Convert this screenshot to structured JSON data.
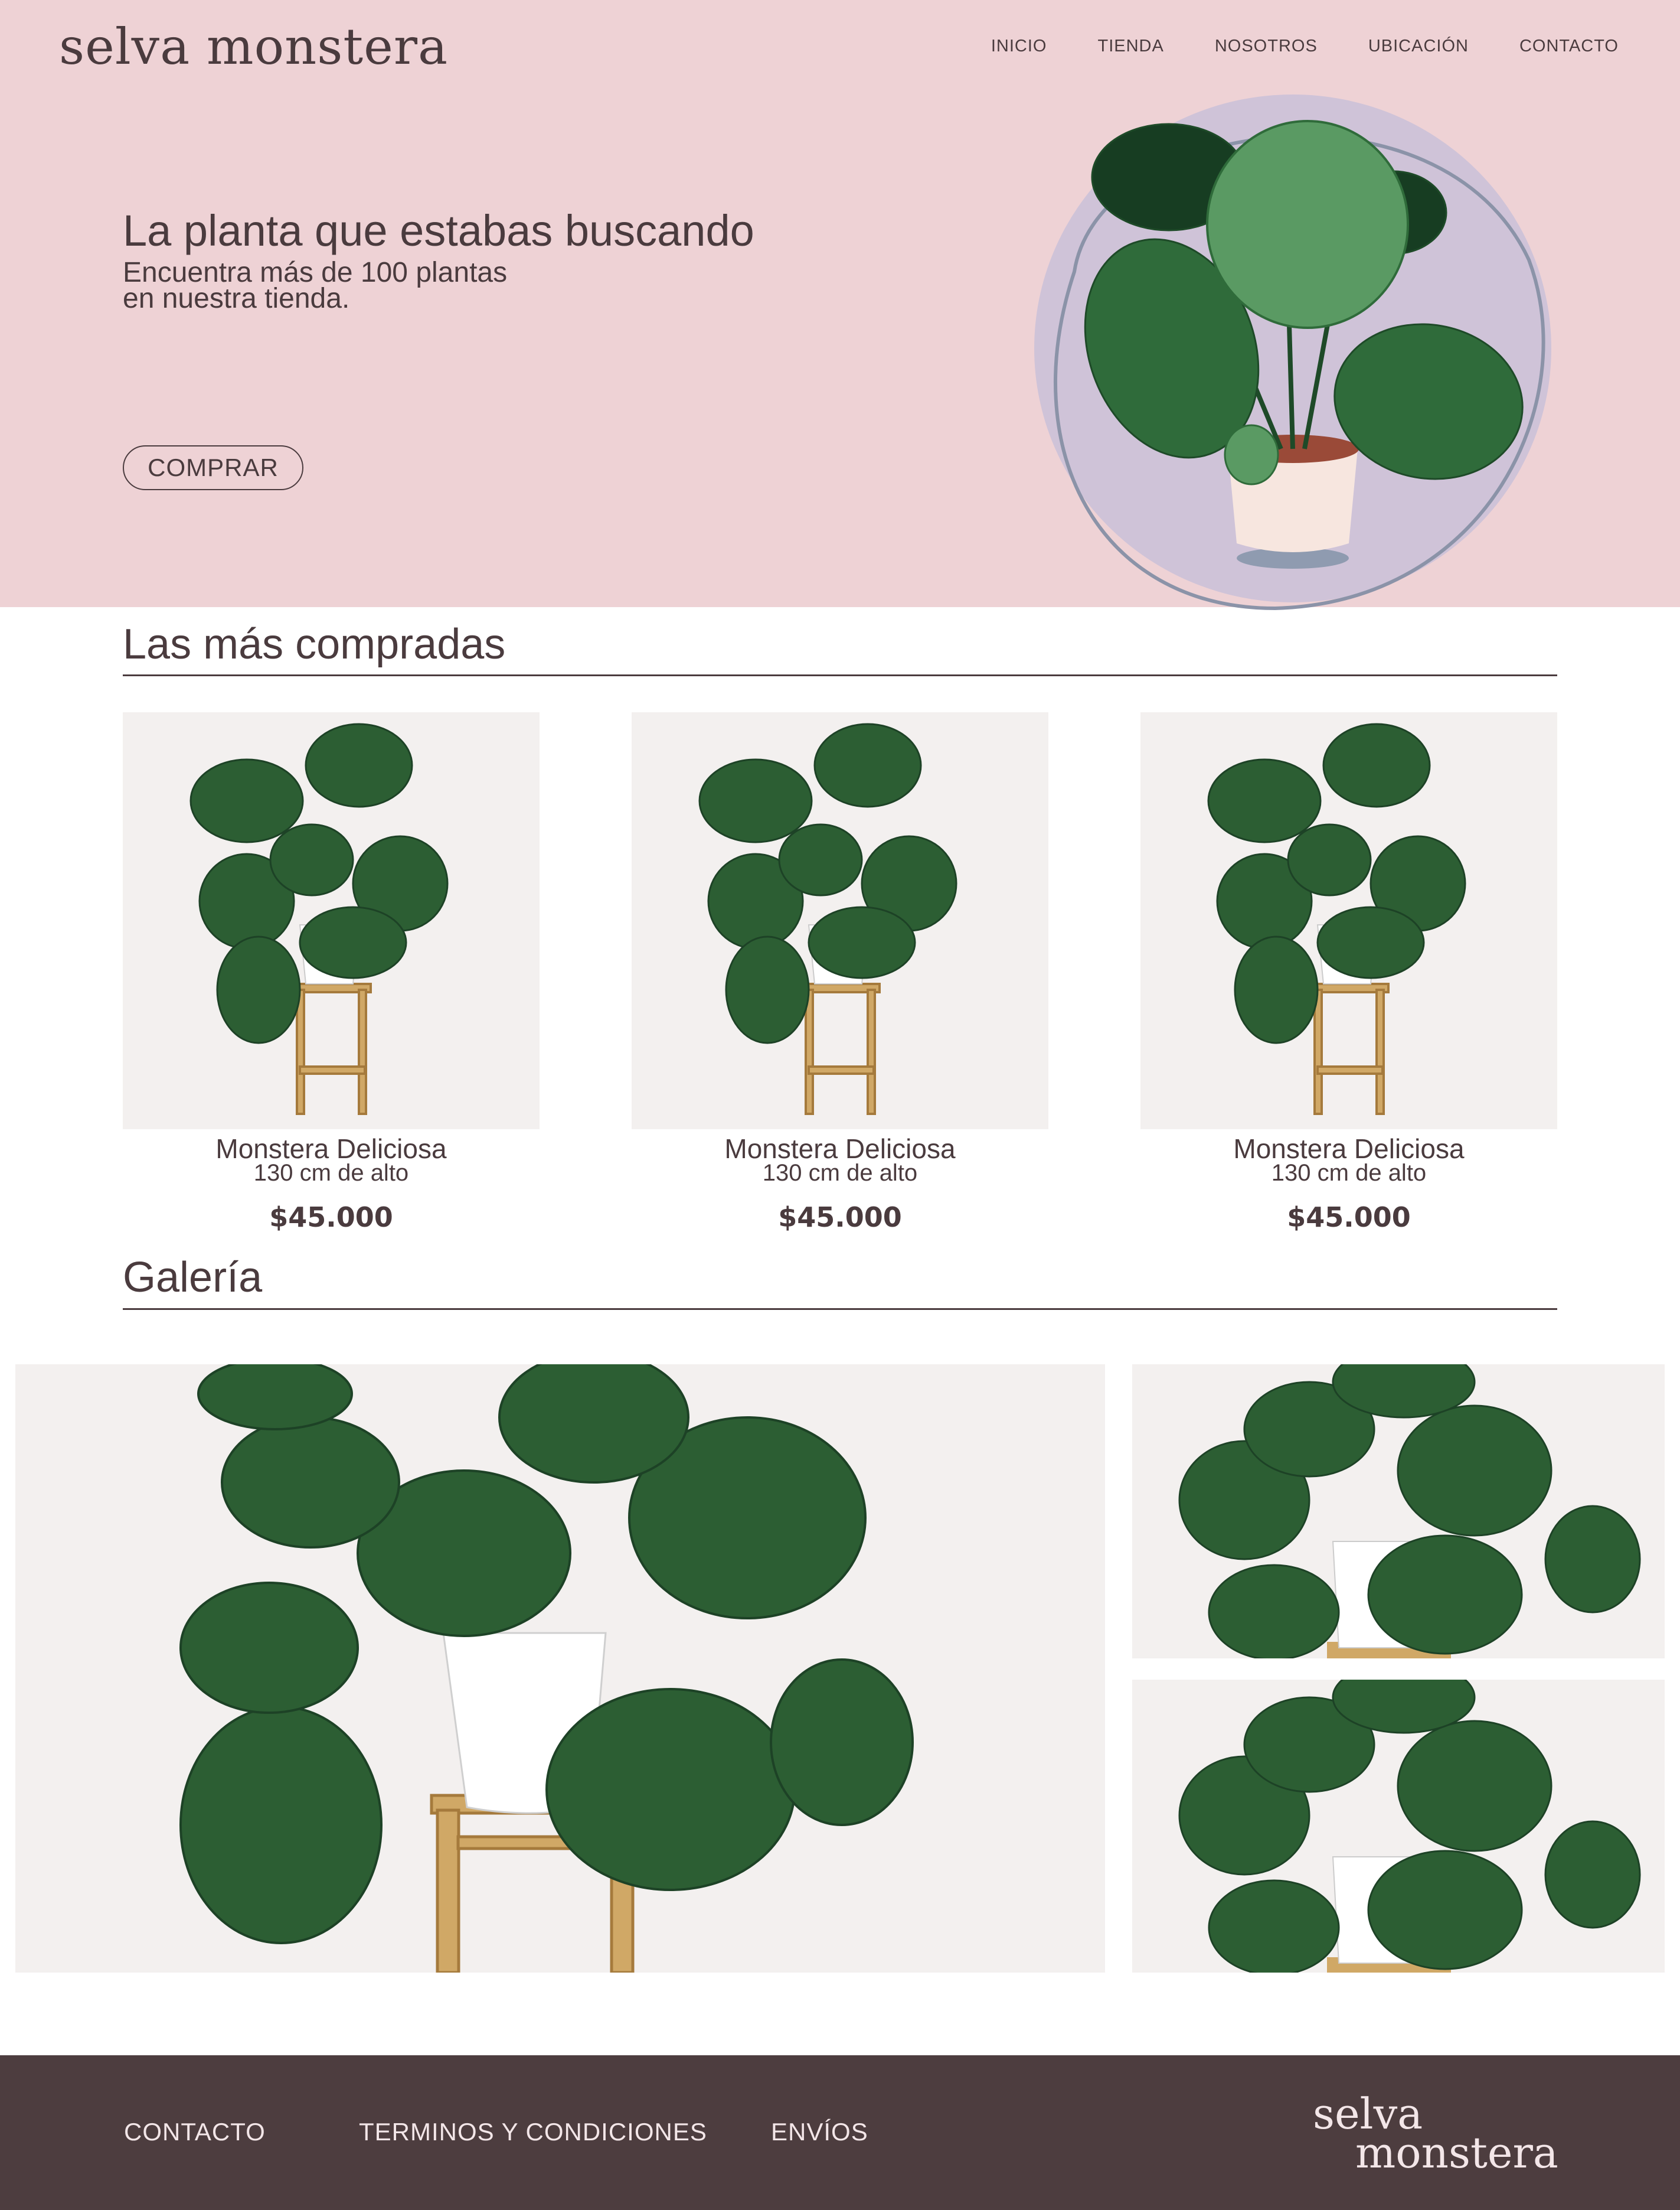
{
  "brand": {
    "name": "selva monstera",
    "footer_line1": "selva",
    "footer_line2": "monstera"
  },
  "nav": {
    "items": [
      "INICIO",
      "TIENDA",
      "NOSOTROS",
      "UBICACIÓN",
      "CONTACTO"
    ]
  },
  "hero": {
    "title": "La planta que estabas buscando",
    "subtitle_line1": "Encuentra más de 100 plantas",
    "subtitle_line2": "en nuestra tienda.",
    "button": "COMPRAR"
  },
  "best_sellers": {
    "title": "Las más compradas",
    "products": [
      {
        "name": "Monstera Deliciosa",
        "height": "130 cm de alto",
        "price": "$45.000"
      },
      {
        "name": "Monstera Deliciosa",
        "height": "130 cm de alto",
        "price": "$45.000"
      },
      {
        "name": "Monstera Deliciosa",
        "height": "130 cm de alto",
        "price": "$45.000"
      }
    ]
  },
  "gallery": {
    "title": "Galería"
  },
  "footer": {
    "links": [
      "CONTACTO",
      "TERMINOS Y CONDICIONES",
      "ENVÍOS"
    ]
  },
  "colors": {
    "hero_bg": "#eed2d5",
    "text": "#4a3b3e",
    "footer_bg": "#4d3d3f",
    "circle": "#cfc3d8",
    "leaf": "#2f6b3a"
  }
}
